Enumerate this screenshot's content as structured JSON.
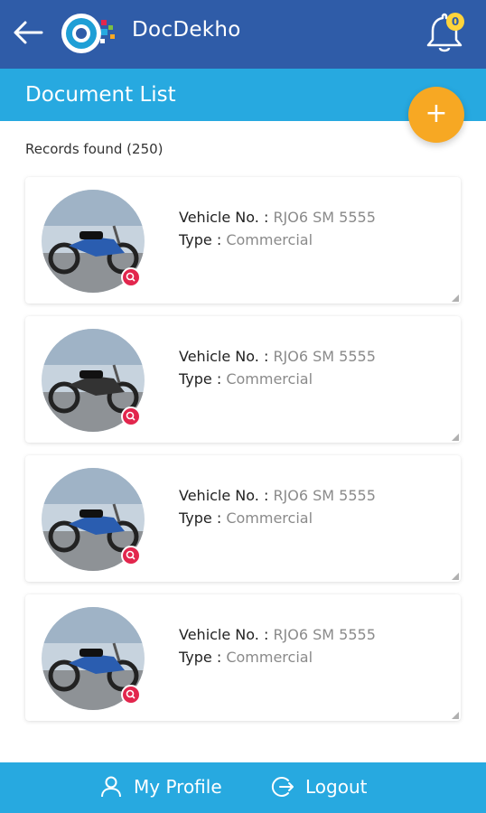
{
  "header": {
    "app_name": "DocDekho",
    "notification_count": "0"
  },
  "page": {
    "title": "Document List",
    "records_label": "Records found (250)",
    "add_button": "+"
  },
  "documents": [
    {
      "vehicle_label": "Vehicle No. :",
      "vehicle_no": "RJO6 SM 5555",
      "type_label": "Type :",
      "type": "Commercial"
    },
    {
      "vehicle_label": "Vehicle No. :",
      "vehicle_no": "RJO6 SM 5555",
      "type_label": "Type :",
      "type": "Commercial"
    },
    {
      "vehicle_label": "Vehicle No. :",
      "vehicle_no": "RJO6 SM 5555",
      "type_label": "Type :",
      "type": "Commercial"
    },
    {
      "vehicle_label": "Vehicle No. :",
      "vehicle_no": "RJO6 SM 5555",
      "type_label": "Type :",
      "type": "Commercial"
    }
  ],
  "bottom_nav": {
    "profile": "My Profile",
    "logout": "Logout"
  },
  "colors": {
    "app_bar": "#2f5ca8",
    "accent": "#27a9e0",
    "fab": "#f7a823",
    "zoom_badge": "#e2264d"
  },
  "icons": [
    "back-arrow-icon",
    "app-logo-icon",
    "bell-icon",
    "add-icon",
    "zoom-icon",
    "user-icon",
    "logout-icon"
  ]
}
